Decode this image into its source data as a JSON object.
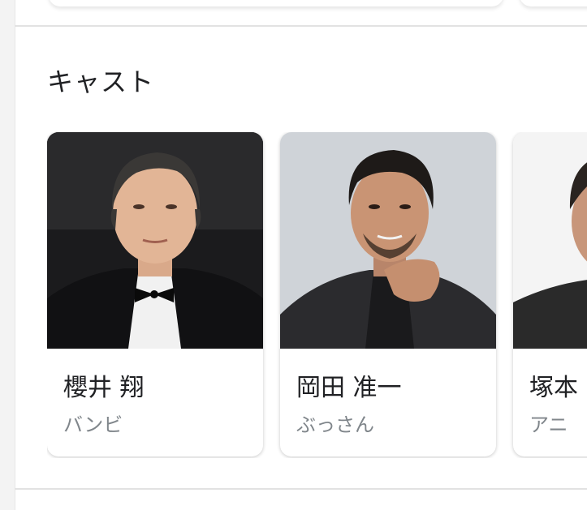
{
  "section": {
    "title": "キャスト"
  },
  "cast": [
    {
      "name": "櫻井 翔",
      "role": "バンビ"
    },
    {
      "name": "岡田 准一",
      "role": "ぶっさん"
    },
    {
      "name": "塚本",
      "role": "アニ"
    }
  ],
  "colors": {
    "title_text": "#202124",
    "secondary_text": "#80868b",
    "card_background": "#ffffff",
    "page_background": "#f3f3f3",
    "divider": "#e2e2e2"
  }
}
